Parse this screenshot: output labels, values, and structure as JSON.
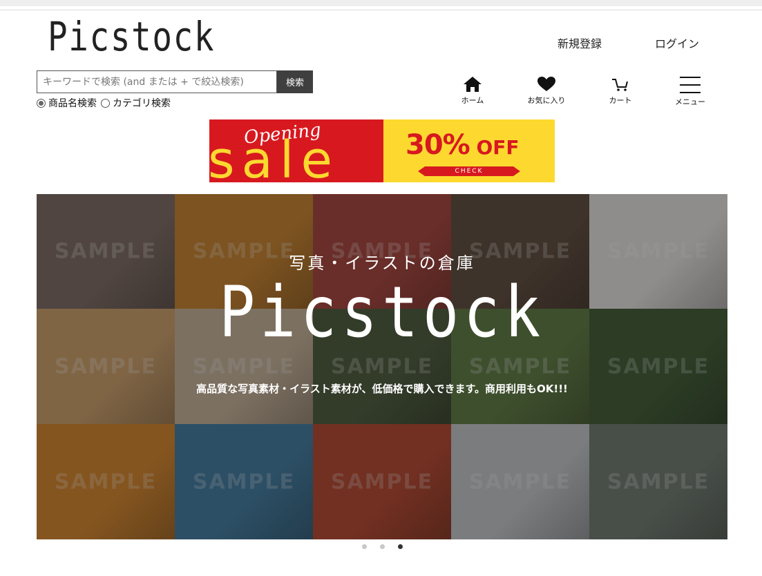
{
  "header": {
    "logo": "Picstock",
    "register_label": "新規登録",
    "login_label": "ログイン"
  },
  "search": {
    "placeholder": "キーワードで検索 (and または + で絞込検索)",
    "button_label": "検索",
    "options": [
      {
        "label": "商品名検索",
        "selected": true
      },
      {
        "label": "カテゴリ検索",
        "selected": false
      }
    ]
  },
  "nav": {
    "items": [
      {
        "label": "ホーム",
        "icon": "home-icon"
      },
      {
        "label": "お気に入り",
        "icon": "heart-icon"
      },
      {
        "label": "カート",
        "icon": "cart-icon"
      },
      {
        "label": "メニュー",
        "icon": "hamburger-icon"
      }
    ]
  },
  "banner": {
    "opening": "Opening",
    "sale": "sale",
    "discount": "30%",
    "off": "OFF",
    "check": "CHECK",
    "colors": {
      "red": "#d7191f",
      "yellow": "#fdd930"
    }
  },
  "hero": {
    "subtitle": "写真・イラストの倉庫",
    "title": "Picstock",
    "description": "高品質な写真素材・イラスト素材が、低価格で購入できます。商用利用もOK!!!",
    "watermark": "SAMPLE",
    "tiles": [
      {
        "name": "wagyu-beef",
        "color": "#7d6a62"
      },
      {
        "name": "mandarin-orange",
        "color": "#c9812b"
      },
      {
        "name": "sushi",
        "color": "#a8423a"
      },
      {
        "name": "fish-market",
        "color": "#5e4a3c"
      },
      {
        "name": "plum-blossom",
        "color": "#e9e6e2"
      },
      {
        "name": "pancakes",
        "color": "#cfa06a"
      },
      {
        "name": "fig-tart",
        "color": "#c9b49a"
      },
      {
        "name": "forest-window",
        "color": "#4a5a3a"
      },
      {
        "name": "tree-road",
        "color": "#5d7a40"
      },
      {
        "name": "tatami-room",
        "color": "#3e5a32"
      },
      {
        "name": "oranges",
        "color": "#d8862a"
      },
      {
        "name": "coastline",
        "color": "#3f7aa0"
      },
      {
        "name": "shrine",
        "color": "#b5452c"
      },
      {
        "name": "snow-village",
        "color": "#c4c8cc"
      },
      {
        "name": "moai-statues",
        "color": "#6f7a70"
      }
    ]
  },
  "carousel": {
    "count": 3,
    "active": 3
  }
}
